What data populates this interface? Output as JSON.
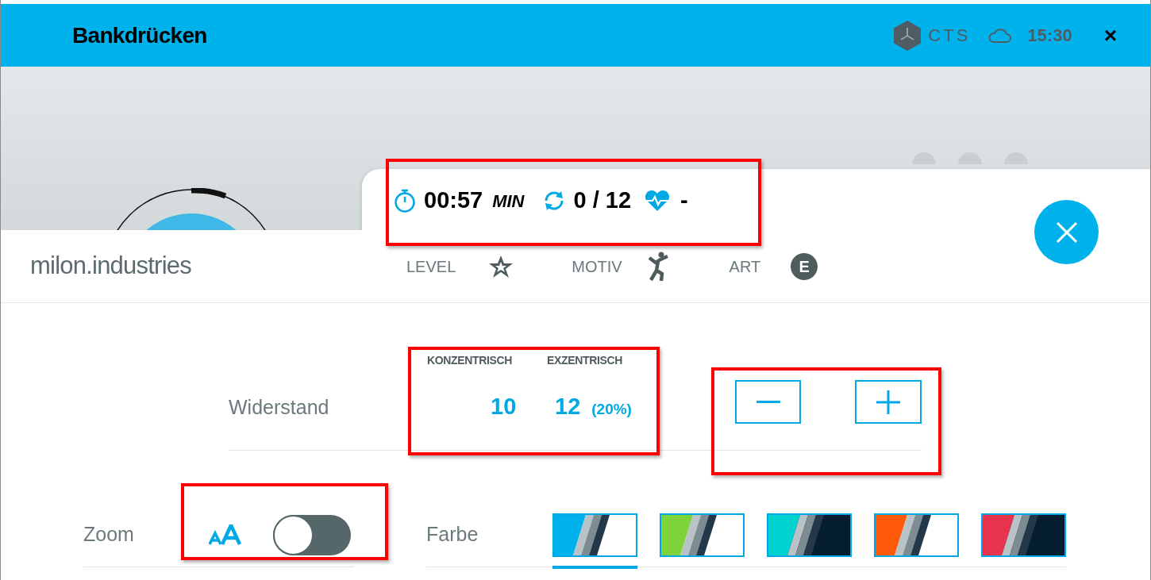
{
  "window": {
    "title": "Bankdrücken",
    "brand": "CTS",
    "time": "15:30",
    "close": "×"
  },
  "stats": {
    "highlighted": true,
    "time": "00:57",
    "time_unit": "MIN",
    "reps": "0 / 12",
    "heart_rate": "-"
  },
  "header": {
    "brand": "milon.industries",
    "items": [
      {
        "kind": "level",
        "label": "LEVEL"
      },
      {
        "kind": "motiv",
        "label": "MOTIV"
      },
      {
        "kind": "art",
        "label": "ART",
        "badge": "E"
      }
    ]
  },
  "resistance": {
    "label": "Widerstand",
    "highlighted": true,
    "columns": [
      {
        "heading": "KONZENTRISCH",
        "value": "10"
      },
      {
        "heading": "EXZENTRISCH",
        "value": "12",
        "extra": "(20%)"
      }
    ],
    "buttons_highlighted": true
  },
  "zoom": {
    "label": "Zoom",
    "highlighted": true,
    "on": false
  },
  "color": {
    "label": "Farbe",
    "swatches": [
      {
        "color": "#00b2ec",
        "kind": "light",
        "selected": true
      },
      {
        "color": "#7ed23a",
        "kind": "light",
        "selected": false
      },
      {
        "color": "#00d2cf",
        "kind": "dark",
        "selected": false
      },
      {
        "color": "#ff5a0a",
        "kind": "light",
        "selected": false
      },
      {
        "color": "#e8334f",
        "kind": "dark",
        "selected": false
      }
    ]
  }
}
